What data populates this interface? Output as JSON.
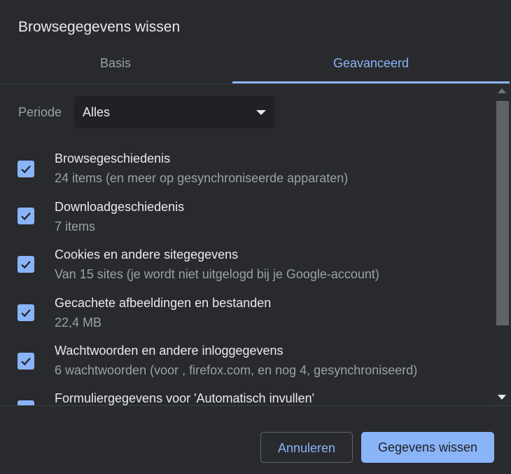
{
  "dialog": {
    "title": "Browsegegevens wissen",
    "tabs": [
      {
        "label": "Basis",
        "selected": false
      },
      {
        "label": "Geavanceerd",
        "selected": true
      }
    ],
    "period": {
      "label": "Periode",
      "value": "Alles"
    },
    "items": [
      {
        "title": "Browsegeschiedenis",
        "subtitle": "24 items (en meer op gesynchroniseerde apparaten)",
        "checked": true
      },
      {
        "title": "Downloadgeschiedenis",
        "subtitle": "7 items",
        "checked": true
      },
      {
        "title": "Cookies en andere sitegegevens",
        "subtitle": "Van 15 sites (je wordt niet uitgelogd bij je Google-account)",
        "checked": true
      },
      {
        "title": "Gecachete afbeeldingen en bestanden",
        "subtitle": "22,4 MB",
        "checked": true
      },
      {
        "title": "Wachtwoorden en andere inloggegevens",
        "subtitle": "6 wachtwoorden (voor , firefox.com, en nog 4, gesynchroniseerd)",
        "checked": true
      },
      {
        "title": "Formuliergegevens voor 'Automatisch invullen'",
        "checked": true
      }
    ],
    "buttons": {
      "cancel": "Annuleren",
      "clear": "Gegevens wissen"
    }
  },
  "colors": {
    "background": "#292a2d",
    "accent": "#8ab4f8",
    "text": "#e8eaed",
    "muted": "#9aa0a6"
  }
}
